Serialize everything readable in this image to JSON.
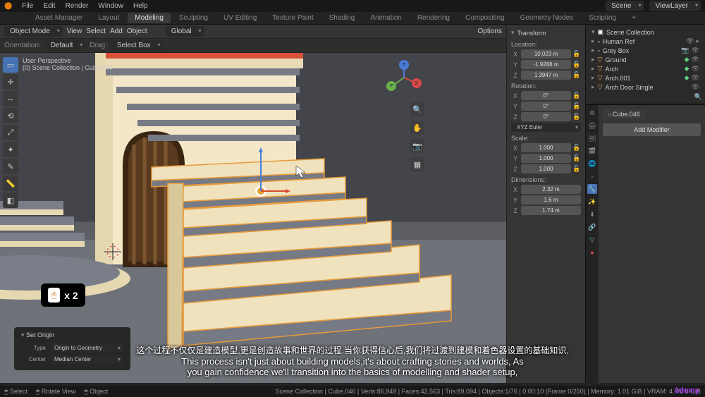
{
  "topmenu": {
    "items": [
      "File",
      "Edit",
      "Render",
      "Window",
      "Help"
    ],
    "scene": "Scene",
    "viewlayer": "ViewLayer"
  },
  "workspaces": [
    "Asset Manager",
    "Layout",
    "Modeling",
    "Sculpting",
    "UV Editing",
    "Texture Paint",
    "Shading",
    "Animation",
    "Rendering",
    "Compositing",
    "Geometry Nodes",
    "Scripting",
    "+"
  ],
  "active_workspace_index": 2,
  "header": {
    "mode": "Object Mode",
    "menu": [
      "View",
      "Select",
      "Add",
      "Object"
    ],
    "orient": "Global",
    "snap": "",
    "options": "Options"
  },
  "orientation_row": {
    "label": "Orientation:",
    "value": "Default",
    "drag": "Drag:",
    "select": "Select Box"
  },
  "viewport_info": {
    "line1": "User Perspective",
    "line2": "(0) Scene Collection | Cube.044"
  },
  "transform": {
    "header": "Transform",
    "location_label": "Location:",
    "loc": {
      "x": "10.023 m",
      "y": "-1.9288 m",
      "z": "1.3947 m"
    },
    "rotation_label": "Rotation:",
    "rot": {
      "x": "0°",
      "y": "0°",
      "z": "0°"
    },
    "rot_mode": "XYZ Euler",
    "scale_label": "Scale:",
    "scale": {
      "x": "1.000",
      "y": "1.000",
      "z": "1.000"
    },
    "dim_label": "Dimensions:",
    "dim": {
      "x": "2.32 m",
      "y": "1.6 m",
      "z": "1.74 m"
    }
  },
  "outliner": {
    "top": "Scene Collection",
    "items": [
      {
        "name": "Human Ref",
        "color": "#e8e8e8"
      },
      {
        "name": "Grey Box",
        "color": "#e8a050"
      },
      {
        "name": "Ground",
        "color": "#7ab0e0"
      },
      {
        "name": "Arch",
        "color": "#7ab0e0"
      },
      {
        "name": "Arch.001",
        "color": "#7ab0e0"
      },
      {
        "name": "Arch Door Single",
        "color": "#7ab0e0"
      }
    ],
    "cube_crumb": "Cube.046",
    "add_modifier": "Add Modifier"
  },
  "redo_panel": {
    "title": "Set Origin",
    "type_label": "Type",
    "type_value": "Origin to Geometry",
    "center_label": "Center",
    "center_value": "Median Center"
  },
  "shortcut": {
    "key": "🖱",
    "multiplier": "x 2"
  },
  "subtitle": {
    "line1": "这个过程不仅仅是建造模型,更是创造故事和世界的过程.当你获得信心后,我们将过渡到建模和着色器设置的基础知识,",
    "line2": "This process isn't just about building models,it's about crafting stories and worlds, As",
    "line3": "you gain confidence we'll transition into the basics of modelling and shader setup,"
  },
  "status": {
    "left": [
      "Select",
      "Rotate View",
      "Object"
    ],
    "right": "Scene Collection | Cube.046 | Verts:86,949 | Faces:42,563 | Tris:89,094 | Objects:1/76 | 0:00:10 (Frame 0/250) | Memory: 1.01 GiB | VRAM: 4.7/8.0 GiB"
  },
  "watermark": "ûdemy"
}
